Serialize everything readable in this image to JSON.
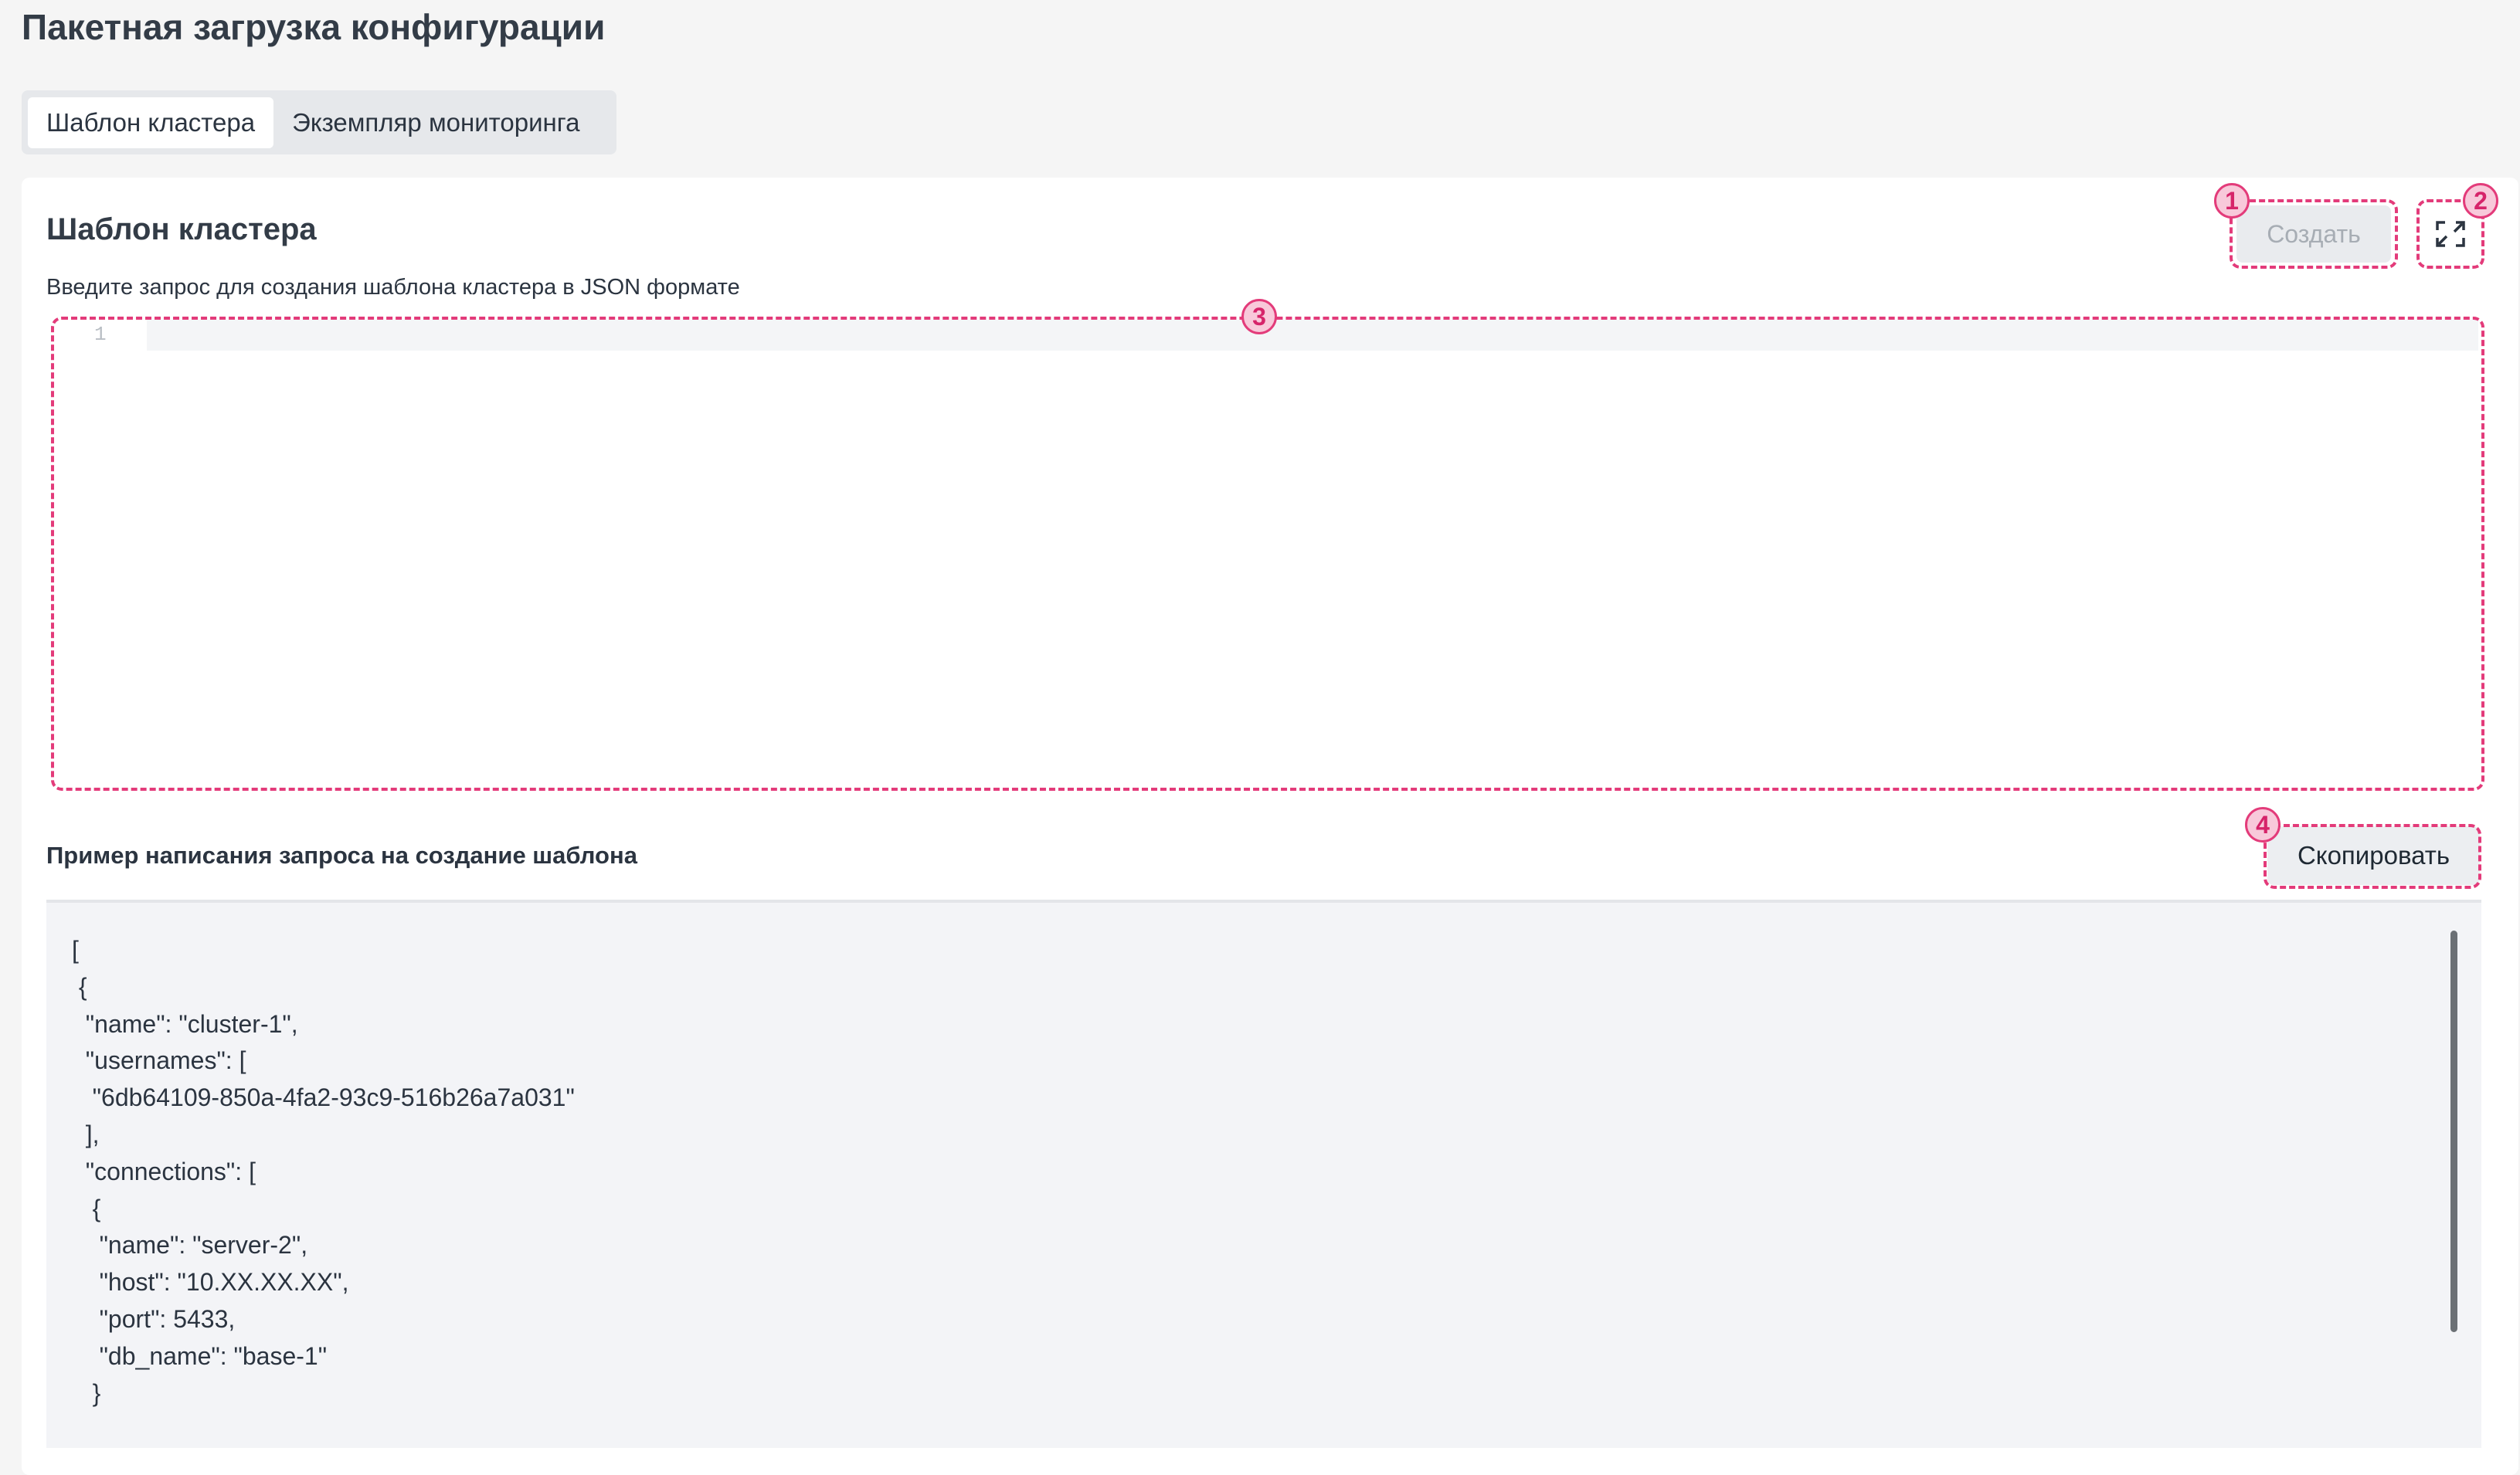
{
  "page": {
    "title": "Пакетная загрузка конфигурации"
  },
  "tabs": [
    {
      "label": "Шаблон кластера",
      "active": true
    },
    {
      "label": "Экземпляр мониторинга",
      "active": false
    }
  ],
  "card": {
    "title": "Шаблон кластера",
    "create_label": "Создать",
    "expand_icon": "expand-icon",
    "hint": "Введите запрос для создания шаблона кластера в JSON формате",
    "editor": {
      "line_number": "1",
      "value": ""
    }
  },
  "example": {
    "title": "Пример написания запроса на создание шаблона",
    "copy_label": "Скопировать",
    "code": "[\n {\n  \"name\": \"cluster-1\",\n  \"usernames\": [\n   \"6db64109-850a-4fa2-93c9-516b26a7a031\"\n  ],\n  \"connections\": [\n   {\n    \"name\": \"server-2\",\n    \"host\": \"10.XX.XX.XX\",\n    \"port\": 5433,\n    \"db_name\": \"base-1\"\n   }"
  },
  "annotations": [
    "1",
    "2",
    "3",
    "4"
  ],
  "colors": {
    "annotation": "#e33b7a",
    "background": "#f5f5f5"
  }
}
